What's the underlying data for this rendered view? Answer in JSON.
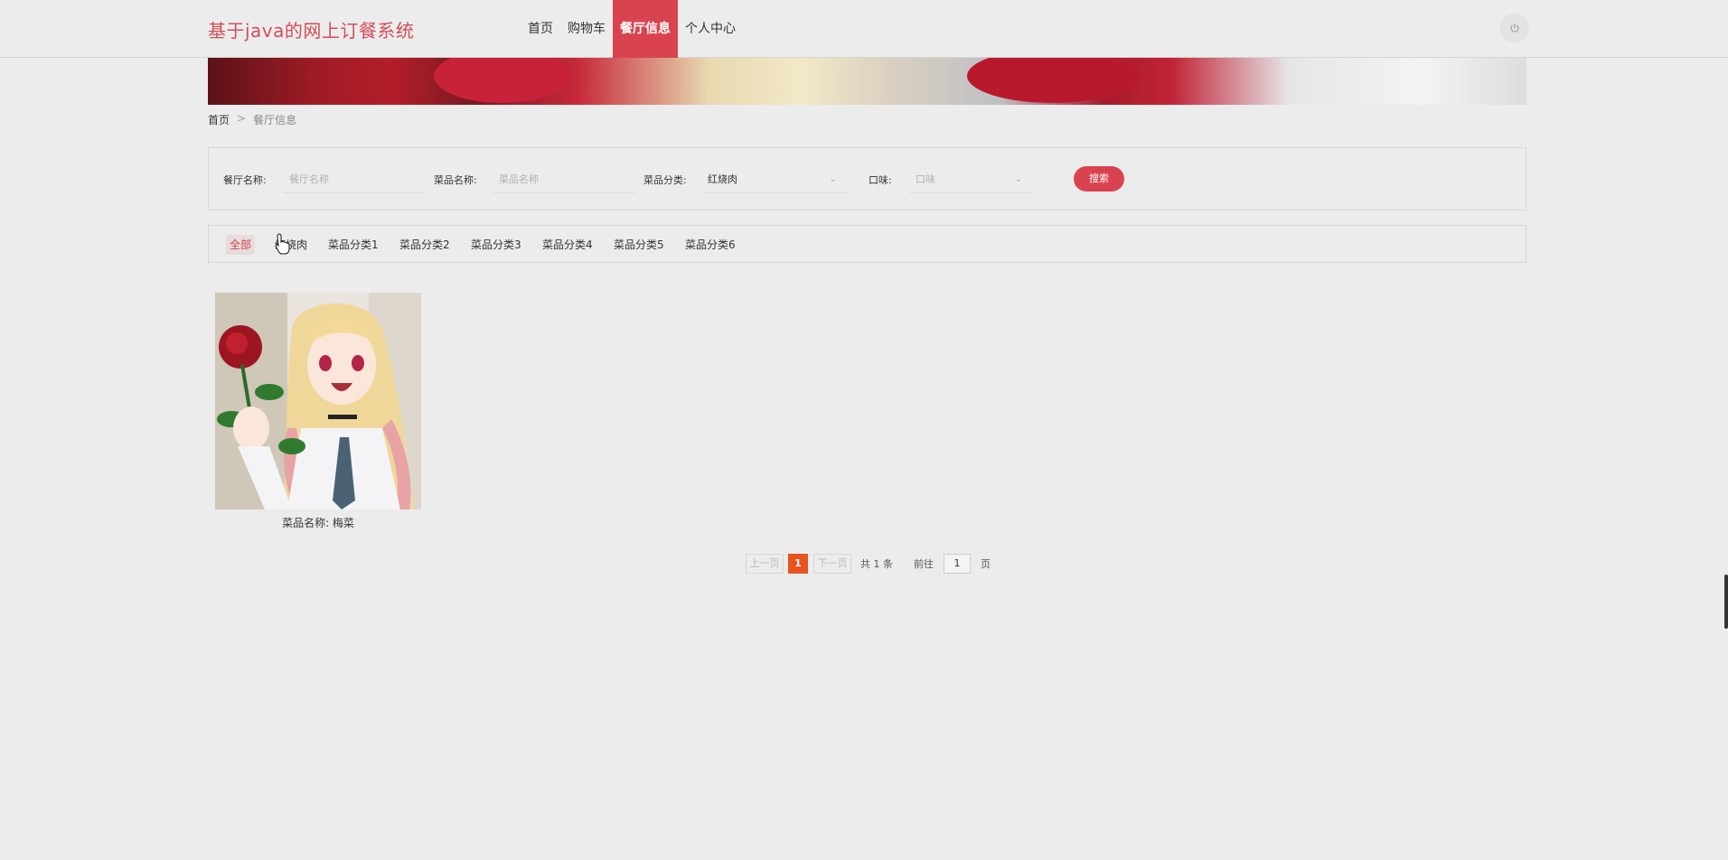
{
  "header": {
    "site_title": "基于java的网上订餐系统",
    "nav": [
      "首页",
      "购物车",
      "餐厅信息",
      "个人中心"
    ],
    "active_nav": "餐厅信息",
    "power_icon": "power-icon"
  },
  "breadcrumb": {
    "home": "首页",
    "separator": ">",
    "current": "餐厅信息"
  },
  "search": {
    "restaurant_label": "餐厅名称:",
    "restaurant_placeholder": "餐厅名称",
    "dish_label": "菜品名称:",
    "dish_placeholder": "菜品名称",
    "category_label": "菜品分类:",
    "category_value": "红烧肉",
    "taste_label": "口味:",
    "taste_placeholder": "口味",
    "button": "搜索"
  },
  "categories": [
    "全部",
    "红烧肉",
    "菜品分类1",
    "菜品分类2",
    "菜品分类3",
    "菜品分类4",
    "菜品分类5",
    "菜品分类6"
  ],
  "active_category": "全部",
  "products": [
    {
      "label": "菜品名称: 梅菜"
    }
  ],
  "pagination": {
    "prev": "上一页",
    "current_page": "1",
    "next": "下一页",
    "total": "共 1 条",
    "goto_prefix": "前往",
    "goto_value": "1",
    "goto_suffix": "页"
  },
  "colors": {
    "accent": "#d9434f",
    "page_active": "#e8541e",
    "background": "#ececec"
  }
}
